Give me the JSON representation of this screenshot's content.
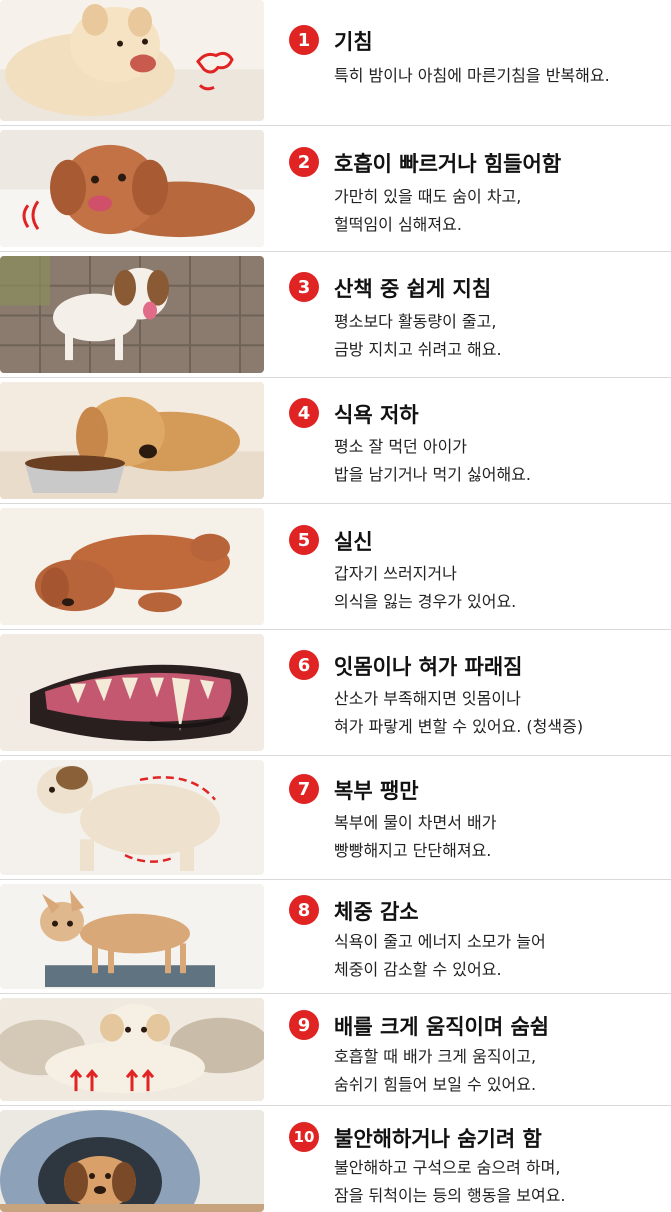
{
  "colors": {
    "badge": "#e02424",
    "divider": "#d9d9d9"
  },
  "items": [
    {
      "num": "1",
      "title": "기침",
      "lines": [
        "특히 밤이나 아침에 마른기침을 반복해요."
      ],
      "image": "coughing-dog-image"
    },
    {
      "num": "2",
      "title": "호흡이 빠르거나 힘들어함",
      "lines": [
        "가만히 있을 때도 숨이 차고,",
        "헐떡임이 심해져요."
      ],
      "image": "panting-dog-image"
    },
    {
      "num": "3",
      "title": "산책 중 쉽게 지침",
      "lines": [
        "평소보다 활동량이 줄고,",
        "금방 지치고 쉬려고 해요."
      ],
      "image": "walking-dog-image"
    },
    {
      "num": "4",
      "title": "식욕 저하",
      "lines": [
        "평소 잘 먹던 아이가",
        "밥을 남기거나 먹기 싫어해요."
      ],
      "image": "dog-food-bowl-image"
    },
    {
      "num": "5",
      "title": "실신",
      "lines": [
        "갑자기 쓰러지거나",
        "의식을 잃는 경우가 있어요."
      ],
      "image": "fainted-dog-image"
    },
    {
      "num": "6",
      "title": "잇몸이나 혀가 파래짐",
      "lines": [
        "산소가 부족해지면 잇몸이나",
        "혀가 파랗게 변할 수 있어요. (청색증)"
      ],
      "image": "dog-gums-image"
    },
    {
      "num": "7",
      "title": "복부 팽만",
      "lines": [
        "복부에 물이 차면서 배가",
        "빵빵해지고 단단해져요."
      ],
      "image": "bloated-dog-image"
    },
    {
      "num": "8",
      "title": "체중 감소",
      "lines": [
        "식욕이 줄고 에너지 소모가 늘어",
        "체중이 감소할 수 있어요."
      ],
      "image": "thin-dog-image"
    },
    {
      "num": "9",
      "title": "배를 크게 움직이며 숨쉼",
      "lines": [
        "호흡할 때 배가 크게 움직이고,",
        "숨쉬기 힘들어 보일 수 있어요."
      ],
      "image": "breathing-dog-image"
    },
    {
      "num": "10",
      "title": "불안해하거나 숨기려 함",
      "lines": [
        "불안해하고 구석으로 숨으려 하며,",
        "잠을 뒤척이는 등의 행동을 보여요."
      ],
      "image": "hiding-dog-image"
    }
  ]
}
